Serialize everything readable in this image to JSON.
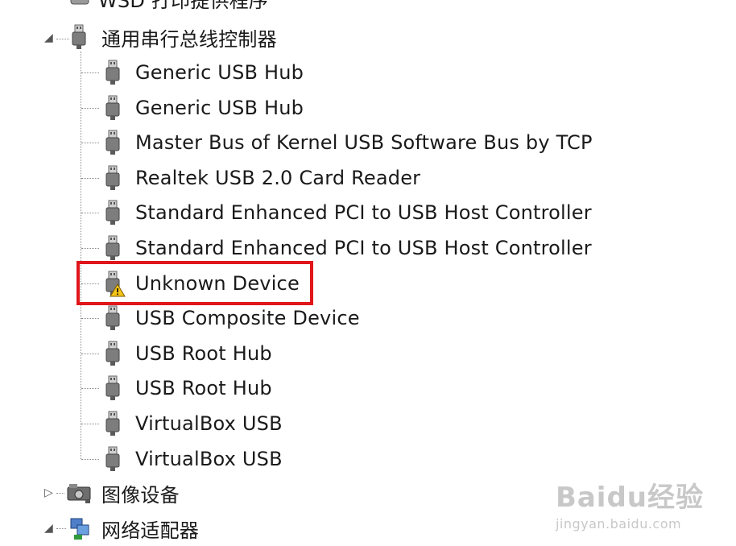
{
  "tree": {
    "partial_top_label": "WSD 打印提供程序",
    "controller_category": {
      "label": "通用串行总线控制器",
      "expander": "◢",
      "children": [
        {
          "label": "Generic USB Hub"
        },
        {
          "label": "Generic USB Hub"
        },
        {
          "label": "Master Bus of Kernel USB Software Bus by TCP"
        },
        {
          "label": "Realtek USB 2.0 Card Reader"
        },
        {
          "label": "Standard Enhanced PCI to USB Host Controller"
        },
        {
          "label": "Standard Enhanced PCI to USB Host Controller"
        },
        {
          "label": "Unknown Device",
          "warning": true
        },
        {
          "label": "USB Composite Device"
        },
        {
          "label": "USB Root Hub"
        },
        {
          "label": "USB Root Hub"
        },
        {
          "label": "VirtualBox USB"
        },
        {
          "label": "VirtualBox USB"
        }
      ]
    },
    "imaging_category": {
      "label": "图像设备",
      "expander": "▷"
    },
    "network_category": {
      "label": "网络适配器",
      "expander": "◢"
    }
  },
  "highlight": {
    "color": "#e0161b",
    "target": "Unknown Device"
  },
  "watermark": {
    "brand": "Baidu经验",
    "url": "jingyan.baidu.com"
  }
}
